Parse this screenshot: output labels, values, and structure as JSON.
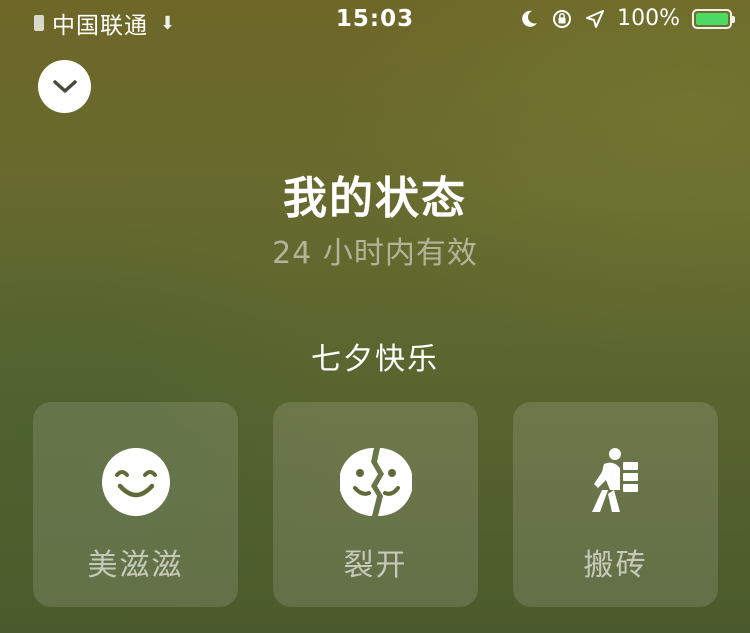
{
  "status_bar": {
    "carrier": "中国联通",
    "time": "15:03",
    "battery": "100%",
    "battery_level": 1.0,
    "icons": [
      "signal-icon",
      "download-icon",
      "moon-icon",
      "lock-rotation-icon",
      "location-arrow-icon",
      "battery-icon"
    ]
  },
  "header": {
    "collapse_icon": "chevron-down-icon"
  },
  "main": {
    "title": "我的状态",
    "subtitle": "24 小时内有效",
    "section_title": "七夕快乐",
    "cards": [
      {
        "label": "美滋滋",
        "icon": "smiley-icon"
      },
      {
        "label": "裂开",
        "icon": "cracked-face-icon"
      },
      {
        "label": "搬砖",
        "icon": "carrying-bricks-icon"
      }
    ]
  },
  "colors": {
    "accent": "#4cd964",
    "card_bg": "rgba(255,255,255,0.13)",
    "background_top": "#6e6728",
    "background_bottom": "#4b5a2c"
  }
}
